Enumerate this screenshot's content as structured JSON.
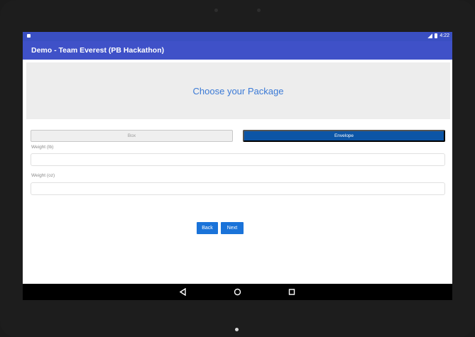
{
  "statusbar": {
    "time": "4:22"
  },
  "toolbar": {
    "title": "Demo - Team Everest (PB Hackathon)"
  },
  "main": {
    "heading": "Choose your Package",
    "package_types": [
      {
        "label": "Box",
        "selected": false
      },
      {
        "label": "Envelope",
        "selected": true
      }
    ],
    "weight_lb": {
      "label": "Weight (lb)",
      "value": ""
    },
    "weight_oz": {
      "label": "Weight (oz)",
      "value": ""
    },
    "back_label": "Back",
    "next_label": "Next"
  },
  "colors": {
    "appbar": "#3f51c8",
    "selected": "#0c55a6",
    "accent_button": "#1a73d9",
    "heading_text": "#3b7ad6"
  },
  "icons": [
    "back-triangle-icon",
    "home-circle-icon",
    "recents-square-icon"
  ]
}
